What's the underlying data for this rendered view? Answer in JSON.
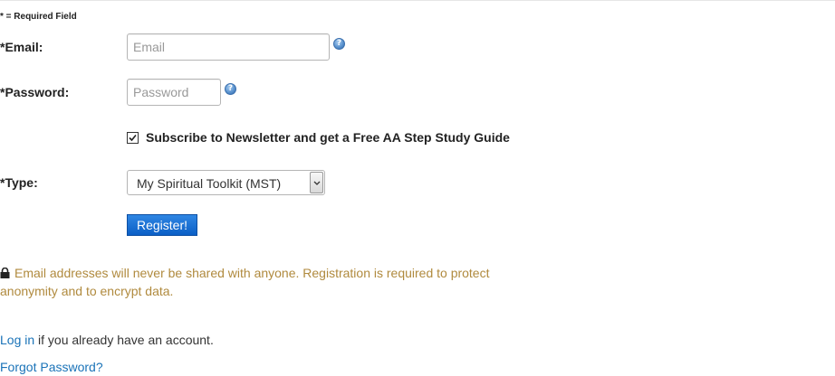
{
  "form": {
    "required_note": "* = Required Field",
    "email": {
      "label": "*Email:",
      "placeholder": "Email",
      "value": "",
      "help_icon": "question-help-icon"
    },
    "password": {
      "label": "*Password:",
      "placeholder": "Password",
      "value": "",
      "help_icon": "question-help-icon"
    },
    "subscribe": {
      "checked": true,
      "label": "Subscribe to Newsletter and get a Free AA Step Study Guide"
    },
    "type": {
      "label": "*Type:",
      "selected": "My Spiritual Toolkit (MST)"
    },
    "register_button": "Register!"
  },
  "privacy": {
    "icon": "lock-icon",
    "text": "Email addresses will never be shared with anyone. Registration is required to protect anonymity and to encrypt data."
  },
  "login": {
    "link_text": "Log in",
    "trailing_text": " if you already have an account."
  },
  "forgot": {
    "link_text": "Forgot Password?"
  },
  "colors": {
    "link": "#1a73b8",
    "privacy_text": "#b08a3e",
    "button": "#1669d0"
  }
}
